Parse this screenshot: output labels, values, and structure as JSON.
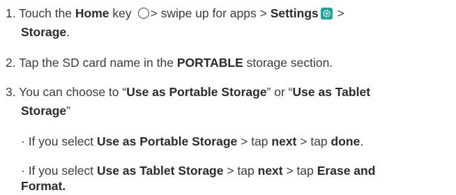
{
  "step1": {
    "num": "1.",
    "a": "Touch the ",
    "b": "Home",
    "c": " key ",
    "d": "> swipe up for apps > ",
    "e": "Settings",
    "f": " >",
    "g": "Storage",
    "h": "."
  },
  "step2": {
    "num": "2.",
    "a": "Tap the SD card name in the ",
    "b": "PORTABLE",
    "c": " storage section."
  },
  "step3": {
    "num": "3.",
    "a": "You can choose to “",
    "b": "Use as Portable Storage",
    "c": "” or “",
    "d": "Use as Tablet",
    "e": "Storage",
    "f": "”"
  },
  "bullet1": {
    "dot": "·",
    "a": " If you select ",
    "b": "Use as Portable Storage",
    "c": " > tap ",
    "d": "next",
    "e": " > tap ",
    "f": "done",
    "g": "."
  },
  "bullet2": {
    "dot": "·",
    "a": " If you select ",
    "b": "Use as Tablet Storage",
    "c": " > tap ",
    "d": "next",
    "e": " > tap ",
    "f": "Erase and",
    "g": "Format."
  },
  "icons": {
    "home": "home-key-icon",
    "settings": "settings-gear-icon",
    "settings_color": "#1aa59a"
  }
}
